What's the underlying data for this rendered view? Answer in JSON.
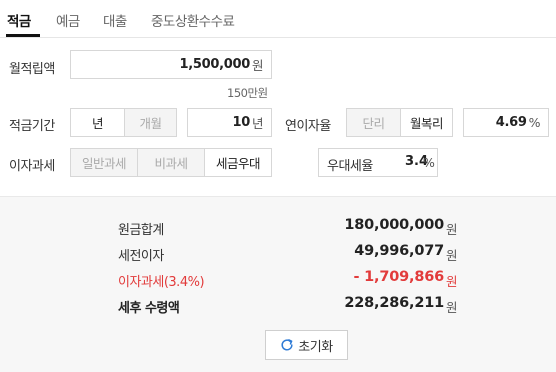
{
  "tabs": [
    {
      "label": "적금"
    },
    {
      "label": "예금"
    },
    {
      "label": "대출"
    },
    {
      "label": "중도상환수수료"
    }
  ],
  "monthly": {
    "label": "월적립액",
    "value": "1,500,000",
    "unit": "원",
    "hint": "150만원"
  },
  "period": {
    "label": "적금기간",
    "opt_year": "년",
    "opt_month": "개월",
    "value": "10",
    "unit": "년"
  },
  "rate": {
    "label": "연이자율",
    "opt_simple": "단리",
    "opt_compound": "월복리",
    "value": "4.69",
    "unit": "%"
  },
  "tax": {
    "label": "이자과세",
    "opt_general": "일반과세",
    "opt_none": "비과세",
    "opt_preferential": "세금우대",
    "pref_label": "우대세율",
    "pref_value": "3.4",
    "pref_unit": "%"
  },
  "result": {
    "principal_label": "원금합계",
    "principal_value": "180,000,000",
    "pretax_label": "세전이자",
    "pretax_value": "49,996,077",
    "tax_label": "이자과세(3.4%)",
    "tax_value": "- 1,709,866",
    "net_label": "세후 수령액",
    "net_value": "228,286,211",
    "unit": "원"
  },
  "reset_label": "초기화",
  "icons": {
    "reset": "refresh-icon"
  },
  "colors": {
    "accent_red": "#e23b3b",
    "result_bg": "#f7f7f7",
    "border": "#d7d7d7"
  }
}
